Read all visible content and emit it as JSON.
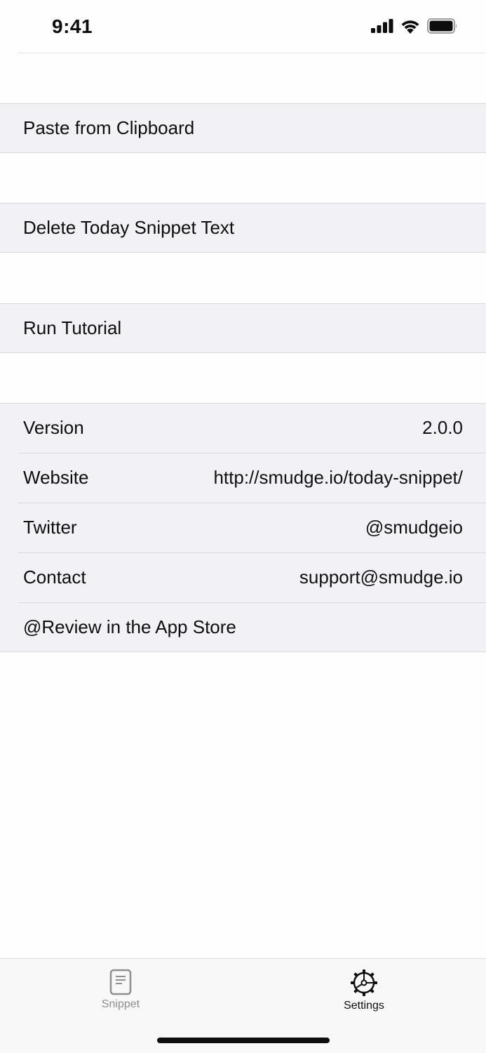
{
  "status_bar": {
    "time": "9:41"
  },
  "actions": [
    {
      "label": "Paste from Clipboard"
    },
    {
      "label": "Delete Today Snippet Text"
    },
    {
      "label": "Run Tutorial"
    }
  ],
  "info": [
    {
      "label": "Version",
      "value": "2.0.0"
    },
    {
      "label": "Website",
      "value": "http://smudge.io/today-snippet/"
    },
    {
      "label": "Twitter",
      "value": "@smudgeio"
    },
    {
      "label": "Contact",
      "value": "support@smudge.io"
    },
    {
      "label": "@Review in the App Store",
      "value": ""
    }
  ],
  "tab_bar": {
    "tabs": [
      {
        "label": "Snippet",
        "icon": "document-icon",
        "selected": false
      },
      {
        "label": "Settings",
        "icon": "gear-icon",
        "selected": true
      }
    ]
  },
  "colors": {
    "group_bg": "#f2f1f6",
    "inactive_tab": "#8e8e93",
    "active_tab": "#0d0d0d"
  }
}
